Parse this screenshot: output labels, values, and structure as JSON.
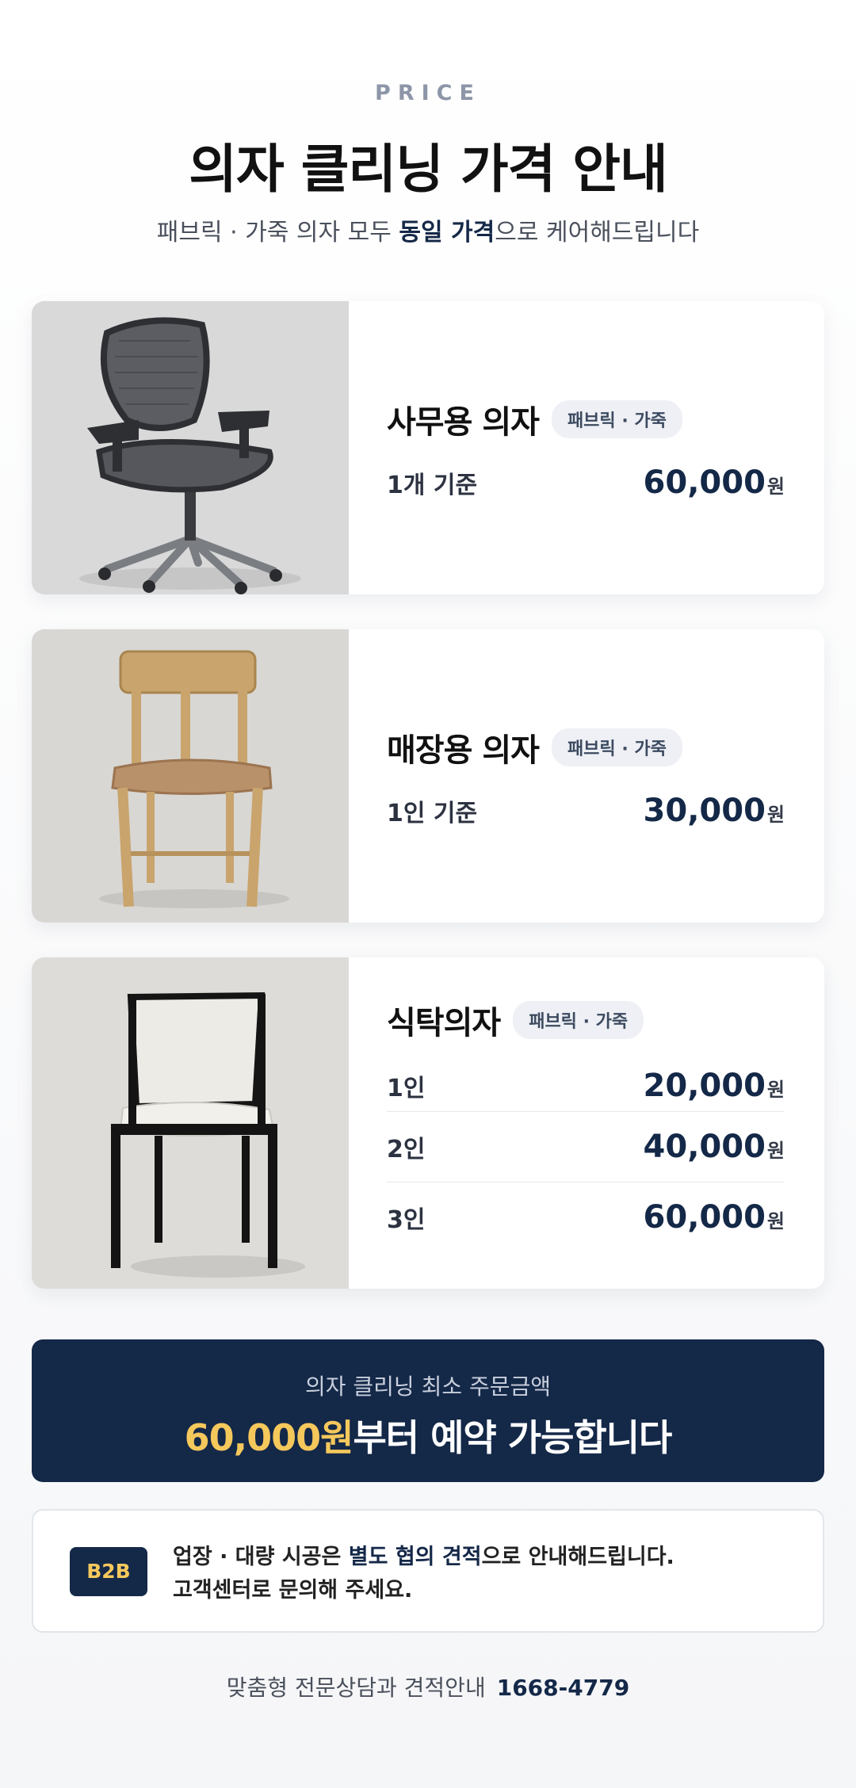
{
  "header": {
    "eyebrow": "PRICE",
    "title": "의자 클리닝 가격 안내",
    "subtitle_pre": "패브릭 · 가죽 의자 모두 ",
    "subtitle_highlight": "동일 가격",
    "subtitle_post": "으로 케어해드립니다"
  },
  "cards": [
    {
      "name": "사무용 의자",
      "tag": "패브릭 · 가죽",
      "image_icon": "office-chair-photo",
      "prices": [
        {
          "label": "1개 기준",
          "amount": "60,000",
          "unit": "원"
        }
      ]
    },
    {
      "name": "매장용 의자",
      "tag": "패브릭 · 가죽",
      "image_icon": "wooden-chair-photo",
      "prices": [
        {
          "label": "1인 기준",
          "amount": "30,000",
          "unit": "원"
        }
      ]
    },
    {
      "name": "식탁의자",
      "tag": "패브릭 · 가죽",
      "image_icon": "dining-chair-photo",
      "prices": [
        {
          "label": "1인",
          "amount": "20,000",
          "unit": "원"
        },
        {
          "label": "2인",
          "amount": "40,000",
          "unit": "원"
        },
        {
          "label": "3인",
          "amount": "60,000",
          "unit": "원"
        }
      ]
    }
  ],
  "cta": {
    "small": "의자 클리닝 최소 주문금액",
    "amount": "60,000원",
    "rest": "부터 예약 가능합니다"
  },
  "b2b": {
    "badge": "B2B",
    "line1_pre": "업장 · 대량 시공은 ",
    "line1_highlight": "별도 협의 견적",
    "line1_post": "으로 안내해드립니다.",
    "line2": "고객센터로 문의해 주세요."
  },
  "contact": {
    "label": "맞춤형 전문상담과 견적안내",
    "phone": "1668-4779"
  },
  "colors": {
    "navy": "#142848",
    "gold": "#f5c85c",
    "tag_bg": "#eef0f5"
  }
}
